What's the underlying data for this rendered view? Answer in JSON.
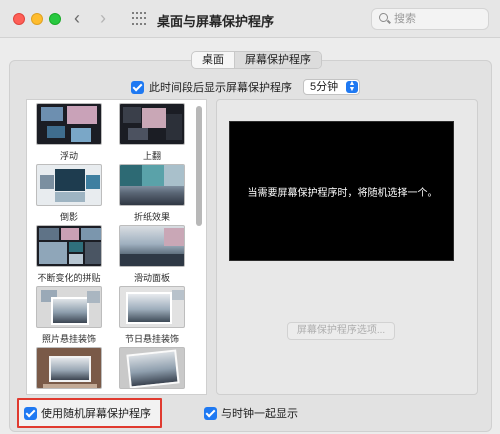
{
  "window": {
    "title": "桌面与屏幕保护程序",
    "search_placeholder": "搜索"
  },
  "tabs": [
    {
      "label": "桌面",
      "active": false
    },
    {
      "label": "屏幕保护程序",
      "active": true
    }
  ],
  "delay": {
    "checked": true,
    "label": "此时间段后显示屏幕保护程序",
    "value": "5分钟"
  },
  "screensavers": [
    {
      "label": "浮动",
      "icon": "floating-thumb"
    },
    {
      "label": "上翻",
      "icon": "flip-up-thumb"
    },
    {
      "label": "倒影",
      "icon": "reflections-thumb"
    },
    {
      "label": "折纸效果",
      "icon": "origami-thumb"
    },
    {
      "label": "不断变化的拼贴",
      "icon": "shifting-tiles-thumb"
    },
    {
      "label": "滑动面板",
      "icon": "sliding-panels-thumb"
    },
    {
      "label": "照片悬挂装饰",
      "icon": "photo-mobile-thumb"
    },
    {
      "label": "节日悬挂装饰",
      "icon": "holiday-mobile-thumb"
    },
    {
      "label": "",
      "icon": "photo-wall-thumb"
    },
    {
      "label": "",
      "icon": "vintage-prints-thumb"
    }
  ],
  "preview": {
    "message": "当需要屏幕保护程序时，将随机选择一个。",
    "options_button": "屏幕保护程序选项..."
  },
  "bottom": {
    "random_checked": true,
    "random_label": "使用随机屏幕保护程序",
    "clock_checked": true,
    "clock_label": "与时钟一起显示"
  },
  "colors": {
    "accent": "#1f79f2",
    "highlight_box": "#e03a2f"
  }
}
